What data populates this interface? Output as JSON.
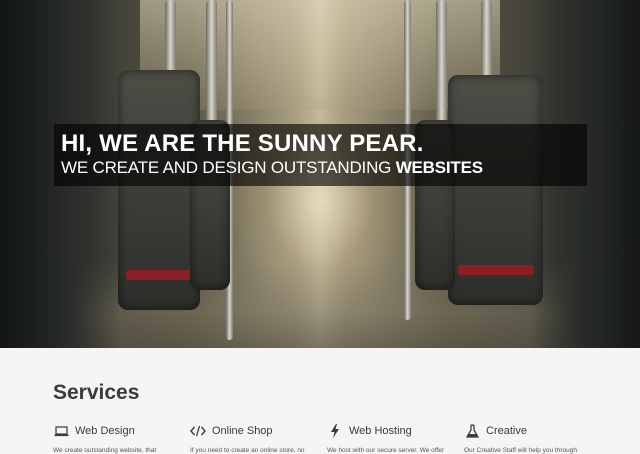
{
  "hero": {
    "heading": "HI, WE ARE THE SUNNY PEAR.",
    "subheading_prefix": "WE CREATE AND DESIGN OUTSTANDING ",
    "subheading_emphasis": "WEBSITES"
  },
  "services": {
    "title": "Services",
    "items": [
      {
        "icon": "laptop-icon",
        "title": "Web Design",
        "description": "We create outstanding website, that"
      },
      {
        "icon": "code-icon",
        "title": "Online Shop",
        "description": "If you need to create an online store, no"
      },
      {
        "icon": "bolt-icon",
        "title": "Web Hosting",
        "description": "We host with our secure server. We offer"
      },
      {
        "icon": "flask-icon",
        "title": "Creative",
        "description": "Our Creative Staff will help you through"
      }
    ]
  }
}
